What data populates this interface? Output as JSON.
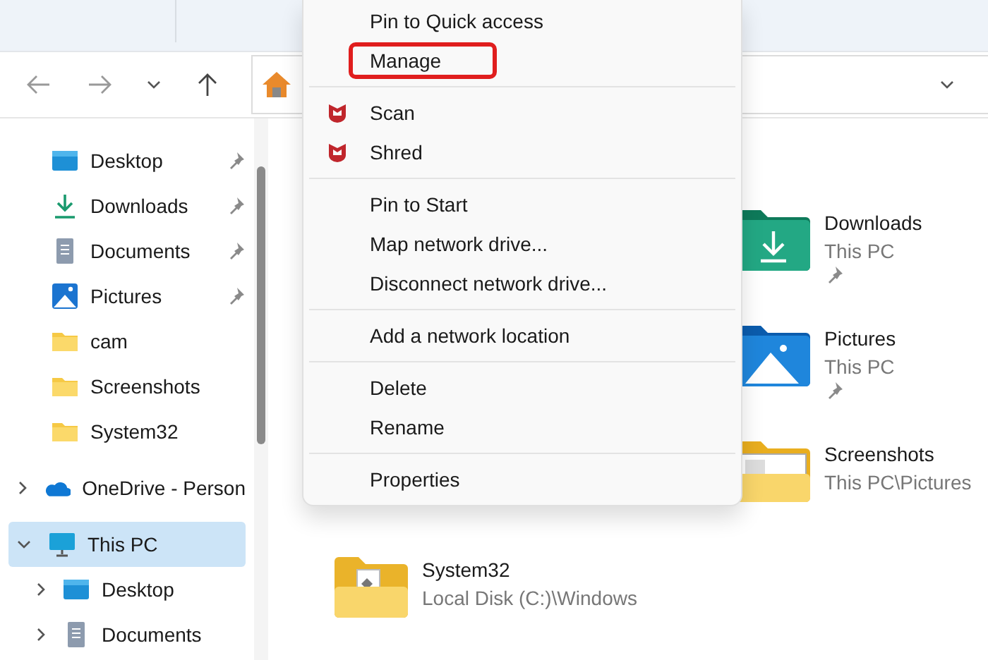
{
  "sidebar": {
    "quick_access": [
      {
        "label": "Desktop",
        "kind": "desktop",
        "pinned": true
      },
      {
        "label": "Downloads",
        "kind": "downloads",
        "pinned": true
      },
      {
        "label": "Documents",
        "kind": "documents",
        "pinned": true
      },
      {
        "label": "Pictures",
        "kind": "pictures",
        "pinned": true
      },
      {
        "label": "cam",
        "kind": "folder",
        "pinned": false
      },
      {
        "label": "Screenshots",
        "kind": "folder",
        "pinned": false
      },
      {
        "label": "System32",
        "kind": "folder",
        "pinned": false
      }
    ],
    "tree": [
      {
        "label": "OneDrive - Person",
        "kind": "onedrive",
        "expanded": false,
        "selected": false
      },
      {
        "label": "This PC",
        "kind": "pc",
        "expanded": true,
        "selected": true,
        "children": [
          {
            "label": "Desktop",
            "kind": "desktop",
            "expanded": false,
            "selected": false
          },
          {
            "label": "Documents",
            "kind": "documents",
            "expanded": false,
            "selected": false
          }
        ]
      }
    ]
  },
  "content": {
    "items": [
      {
        "name": "Downloads",
        "location": "This PC",
        "kind": "downloads",
        "pinned": true
      },
      {
        "name": "Pictures",
        "location": "This PC",
        "kind": "pictures",
        "pinned": true
      },
      {
        "name": "Screenshots",
        "location": "This PC\\Pictures",
        "kind": "screenshots",
        "pinned": false
      },
      {
        "name": "System32",
        "location": "Local Disk (C:)\\Windows",
        "kind": "system",
        "pinned": false
      }
    ]
  },
  "context_menu": {
    "items": [
      {
        "kind": "item",
        "label": "Pin to Quick access",
        "highlighted": false
      },
      {
        "kind": "item",
        "label": "Manage",
        "highlighted": true
      },
      {
        "kind": "separator"
      },
      {
        "kind": "antivirus",
        "label": "Scan",
        "highlighted": false
      },
      {
        "kind": "antivirus",
        "label": "Shred",
        "highlighted": false
      },
      {
        "kind": "separator"
      },
      {
        "kind": "item",
        "label": "Pin to Start",
        "highlighted": false
      },
      {
        "kind": "item",
        "label": "Map network drive...",
        "highlighted": false
      },
      {
        "kind": "item",
        "label": "Disconnect network drive...",
        "highlighted": false
      },
      {
        "kind": "separator"
      },
      {
        "kind": "item",
        "label": "Add a network location",
        "highlighted": false
      },
      {
        "kind": "separator"
      },
      {
        "kind": "item",
        "label": "Delete",
        "highlighted": false
      },
      {
        "kind": "item",
        "label": "Rename",
        "highlighted": false
      },
      {
        "kind": "separator"
      },
      {
        "kind": "item",
        "label": "Properties",
        "highlighted": false
      }
    ]
  }
}
